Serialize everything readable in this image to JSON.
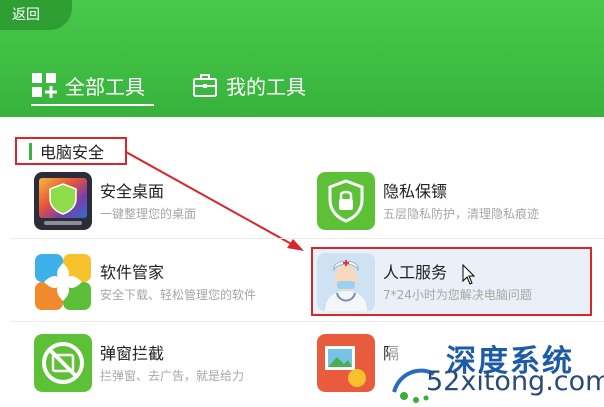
{
  "header": {
    "back_label": "返回"
  },
  "tabs": [
    {
      "label": "全部工具",
      "icon": "grid-plus-icon",
      "active": true
    },
    {
      "label": "我的工具",
      "icon": "toolbox-icon",
      "active": false
    }
  ],
  "section": {
    "title": "电脑安全"
  },
  "tools": [
    {
      "name": "安全桌面",
      "desc": "一键整理您的桌面",
      "icon": "safe-desktop-icon"
    },
    {
      "name": "隐私保镖",
      "desc": "五层隐私防护，清理隐私痕迹",
      "icon": "privacy-guard-icon"
    },
    {
      "name": "软件管家",
      "desc": "安全下载、轻松管理您的软件",
      "icon": "software-manager-icon"
    },
    {
      "name": "人工服务",
      "desc": "7*24小时为您解决电脑问题",
      "icon": "doctor-icon"
    },
    {
      "name": "弹窗拦截",
      "desc": "拦弹窗、去广告，就是给力",
      "icon": "popup-block-icon"
    },
    {
      "name": "隔",
      "desc": "",
      "icon": "photo-icon"
    }
  ],
  "watermark": {
    "brand": "深度系统",
    "url": "52xitong.com"
  },
  "colors": {
    "header_green": "#3fbd43",
    "highlight_red": "#d9262b",
    "accent_green": "#3cb53f"
  }
}
